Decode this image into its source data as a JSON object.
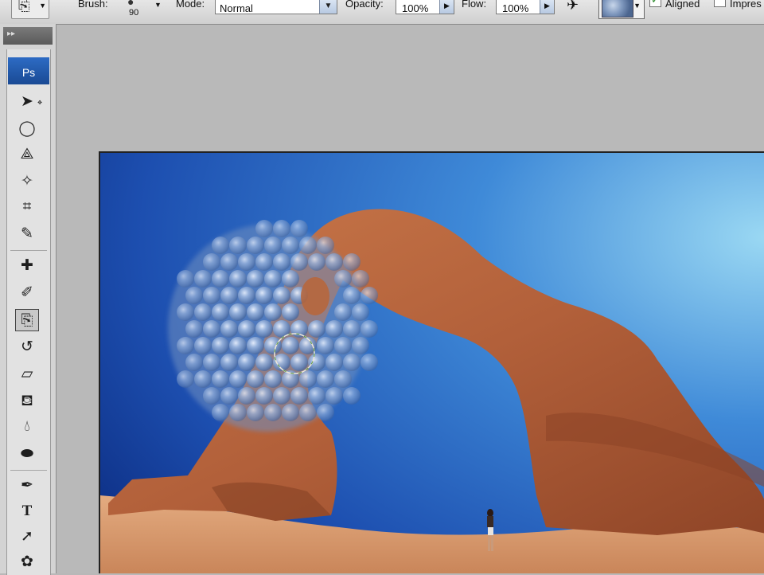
{
  "options_bar": {
    "brush_label": "Brush:",
    "brush_size": "90",
    "mode_label": "Mode:",
    "mode_value": "Normal",
    "opacity_label": "Opacity:",
    "opacity_value": "100%",
    "flow_label": "Flow:",
    "flow_value": "100%",
    "aligned_label": "Aligned",
    "aligned_checked": true,
    "impressionist_label": "Impres",
    "impressionist_checked": false
  },
  "tools": {
    "logo": "Ps",
    "type_tool_glyph": "T",
    "items": [
      {
        "name": "move-tool",
        "icon": "move-icon"
      },
      {
        "name": "marquee-tool",
        "icon": "ellipse-marquee-icon"
      },
      {
        "name": "lasso-tool",
        "icon": "polygonal-lasso-icon"
      },
      {
        "name": "magic-wand-tool",
        "icon": "magic-wand-icon"
      },
      {
        "name": "crop-tool",
        "icon": "crop-icon"
      },
      {
        "name": "eyedropper-tool",
        "icon": "eyedropper-icon"
      },
      {
        "name": "healing-brush-tool",
        "icon": "bandage-icon"
      },
      {
        "name": "brush-tool",
        "icon": "brush-icon"
      },
      {
        "name": "pattern-stamp-tool",
        "icon": "pattern-stamp-icon",
        "active": true
      },
      {
        "name": "history-brush-tool",
        "icon": "history-brush-icon"
      },
      {
        "name": "eraser-tool",
        "icon": "eraser-icon"
      },
      {
        "name": "paint-bucket-tool",
        "icon": "paint-bucket-icon"
      },
      {
        "name": "blur-tool",
        "icon": "blur-drop-icon"
      },
      {
        "name": "dodge-tool",
        "icon": "dodge-icon"
      },
      {
        "name": "pen-tool",
        "icon": "pen-icon"
      },
      {
        "name": "type-tool",
        "icon": "type-icon"
      },
      {
        "name": "path-selection-tool",
        "icon": "arrow-icon"
      },
      {
        "name": "custom-shape-tool",
        "icon": "shape-icon"
      }
    ]
  },
  "colors": {
    "sky_dark": "#0d2f86",
    "sky_mid": "#2766c3",
    "sky_light": "#8fd2f0",
    "rock": "#b5643a",
    "rock_dark": "#7a3a1f",
    "ground": "#d69a70",
    "pattern_blue": "#6f8fc0"
  }
}
